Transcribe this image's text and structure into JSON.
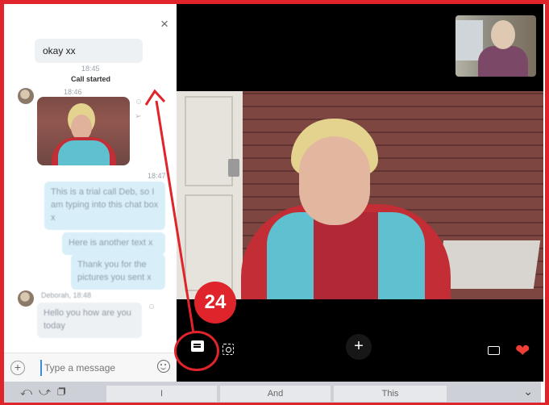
{
  "annotation": {
    "step_number": "24"
  },
  "chat": {
    "close_icon": "×",
    "messages": {
      "first_text": "okay xx",
      "time_1": "18:45",
      "call_started": "Call started",
      "time_2": "18:46",
      "time_3": "18:47",
      "blue_1": "This is a trial call Deb, so I am typing into this chat box x",
      "blue_2": "Here is another text x",
      "blue_3": "Thank you for the pictures you sent x",
      "incoming_sender_time": "Deborah, 18:48",
      "incoming_text": "Hello you how are you today"
    },
    "input": {
      "placeholder": "Type a message",
      "plus_icon": "+"
    }
  },
  "video": {
    "add_icon": "+",
    "heart_icon": "❤"
  },
  "keyboard": {
    "left_icons": "⤺⤻❐",
    "suggestions": [
      "I",
      "And",
      "This"
    ],
    "collapse_icon": "⌄"
  }
}
